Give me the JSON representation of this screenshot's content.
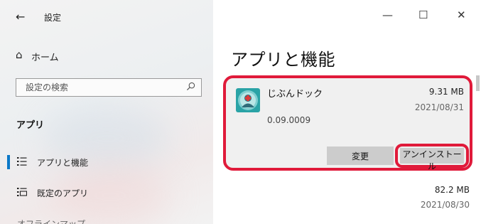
{
  "window": {
    "title": "設定",
    "controls": {
      "minimize": "—",
      "maximize": "☐",
      "close": "✕"
    }
  },
  "sidebar": {
    "back_icon": "←",
    "home": {
      "icon": "⌂",
      "label": "ホーム"
    },
    "search": {
      "placeholder": "設定の検索",
      "icon": "search-icon"
    },
    "section_title": "アプリ",
    "items": [
      {
        "label": "アプリと機能",
        "icon": "list-icon",
        "selected": true
      },
      {
        "label": "既定のアプリ",
        "icon": "default-apps-icon",
        "selected": false
      }
    ],
    "partial_next_item": "オフラインマップ"
  },
  "main": {
    "page_title": "アプリと機能",
    "selected_app": {
      "name": "じぶんドック",
      "size": "9.31 MB",
      "date": "2021/08/31",
      "version": "0.09.0009",
      "change_button": "変更",
      "uninstall_button": "アンインストール"
    },
    "next_app": {
      "size": "82.2 MB",
      "date": "2021/08/30"
    }
  },
  "colors": {
    "accent": "#0a78c8",
    "highlight": "#e01a3a",
    "app_icon_bg": "#2aa3a6",
    "button_bg": "#cccccc"
  }
}
